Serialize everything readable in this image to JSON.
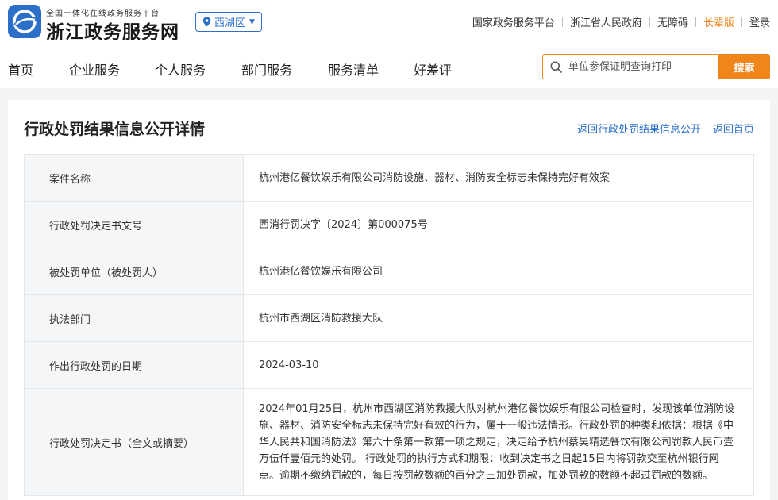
{
  "header": {
    "platform_tagline": "全国一体化在线政务服务平台",
    "site_name": "浙江政务服务网",
    "region": "西湖区",
    "top_links": [
      "国家政务服务平台",
      "浙江省人民政府",
      "无障碍",
      "长辈版",
      "登录"
    ],
    "accent_color": "#f08519",
    "link_color": "#2b6fc9"
  },
  "nav": {
    "items": [
      "首页",
      "企业服务",
      "个人服务",
      "部门服务",
      "服务清单",
      "好差评"
    ]
  },
  "search": {
    "placeholder": "单位参保证明查询打印",
    "button": "搜索"
  },
  "page": {
    "title": "行政处罚结果信息公开详情",
    "back_link": "返回行政处罚结果信息公开",
    "home_link": "返回首页"
  },
  "details": [
    {
      "label": "案件名称",
      "value": "杭州港亿餐饮娱乐有限公司消防设施、器材、消防安全标志未保持完好有效案"
    },
    {
      "label": "行政处罚决定书文号",
      "value": "西消行罚决字〔2024〕第000075号"
    },
    {
      "label": "被处罚单位（被处罚人）",
      "value": "杭州港亿餐饮娱乐有限公司"
    },
    {
      "label": "执法部门",
      "value": "杭州市西湖区消防救援大队"
    },
    {
      "label": "作出行政处罚的日期",
      "value": "2024-03-10"
    },
    {
      "label": "行政处罚决定书（全文或摘要）",
      "value": "2024年01月25日，杭州市西湖区消防救援大队对杭州港亿餐饮娱乐有限公司检查时，发现该单位消防设施、器材、消防安全标志未保持完好有效的行为，属于一般违法情形。行政处罚的种类和依据：根据《中华人民共和国消防法》第六十条第一款第一项之规定，决定给予杭州蔡昊精选餐饮有限公司罚款人民币壹万伍仟壹佰元的处罚。 行政处罚的执行方式和期限：收到决定书之日起15日内将罚款交至杭州银行网点。逾期不缴纳罚款的，每日按罚款数额的百分之三加处罚款，加处罚款的数额不超过罚款的数额。"
    }
  ]
}
